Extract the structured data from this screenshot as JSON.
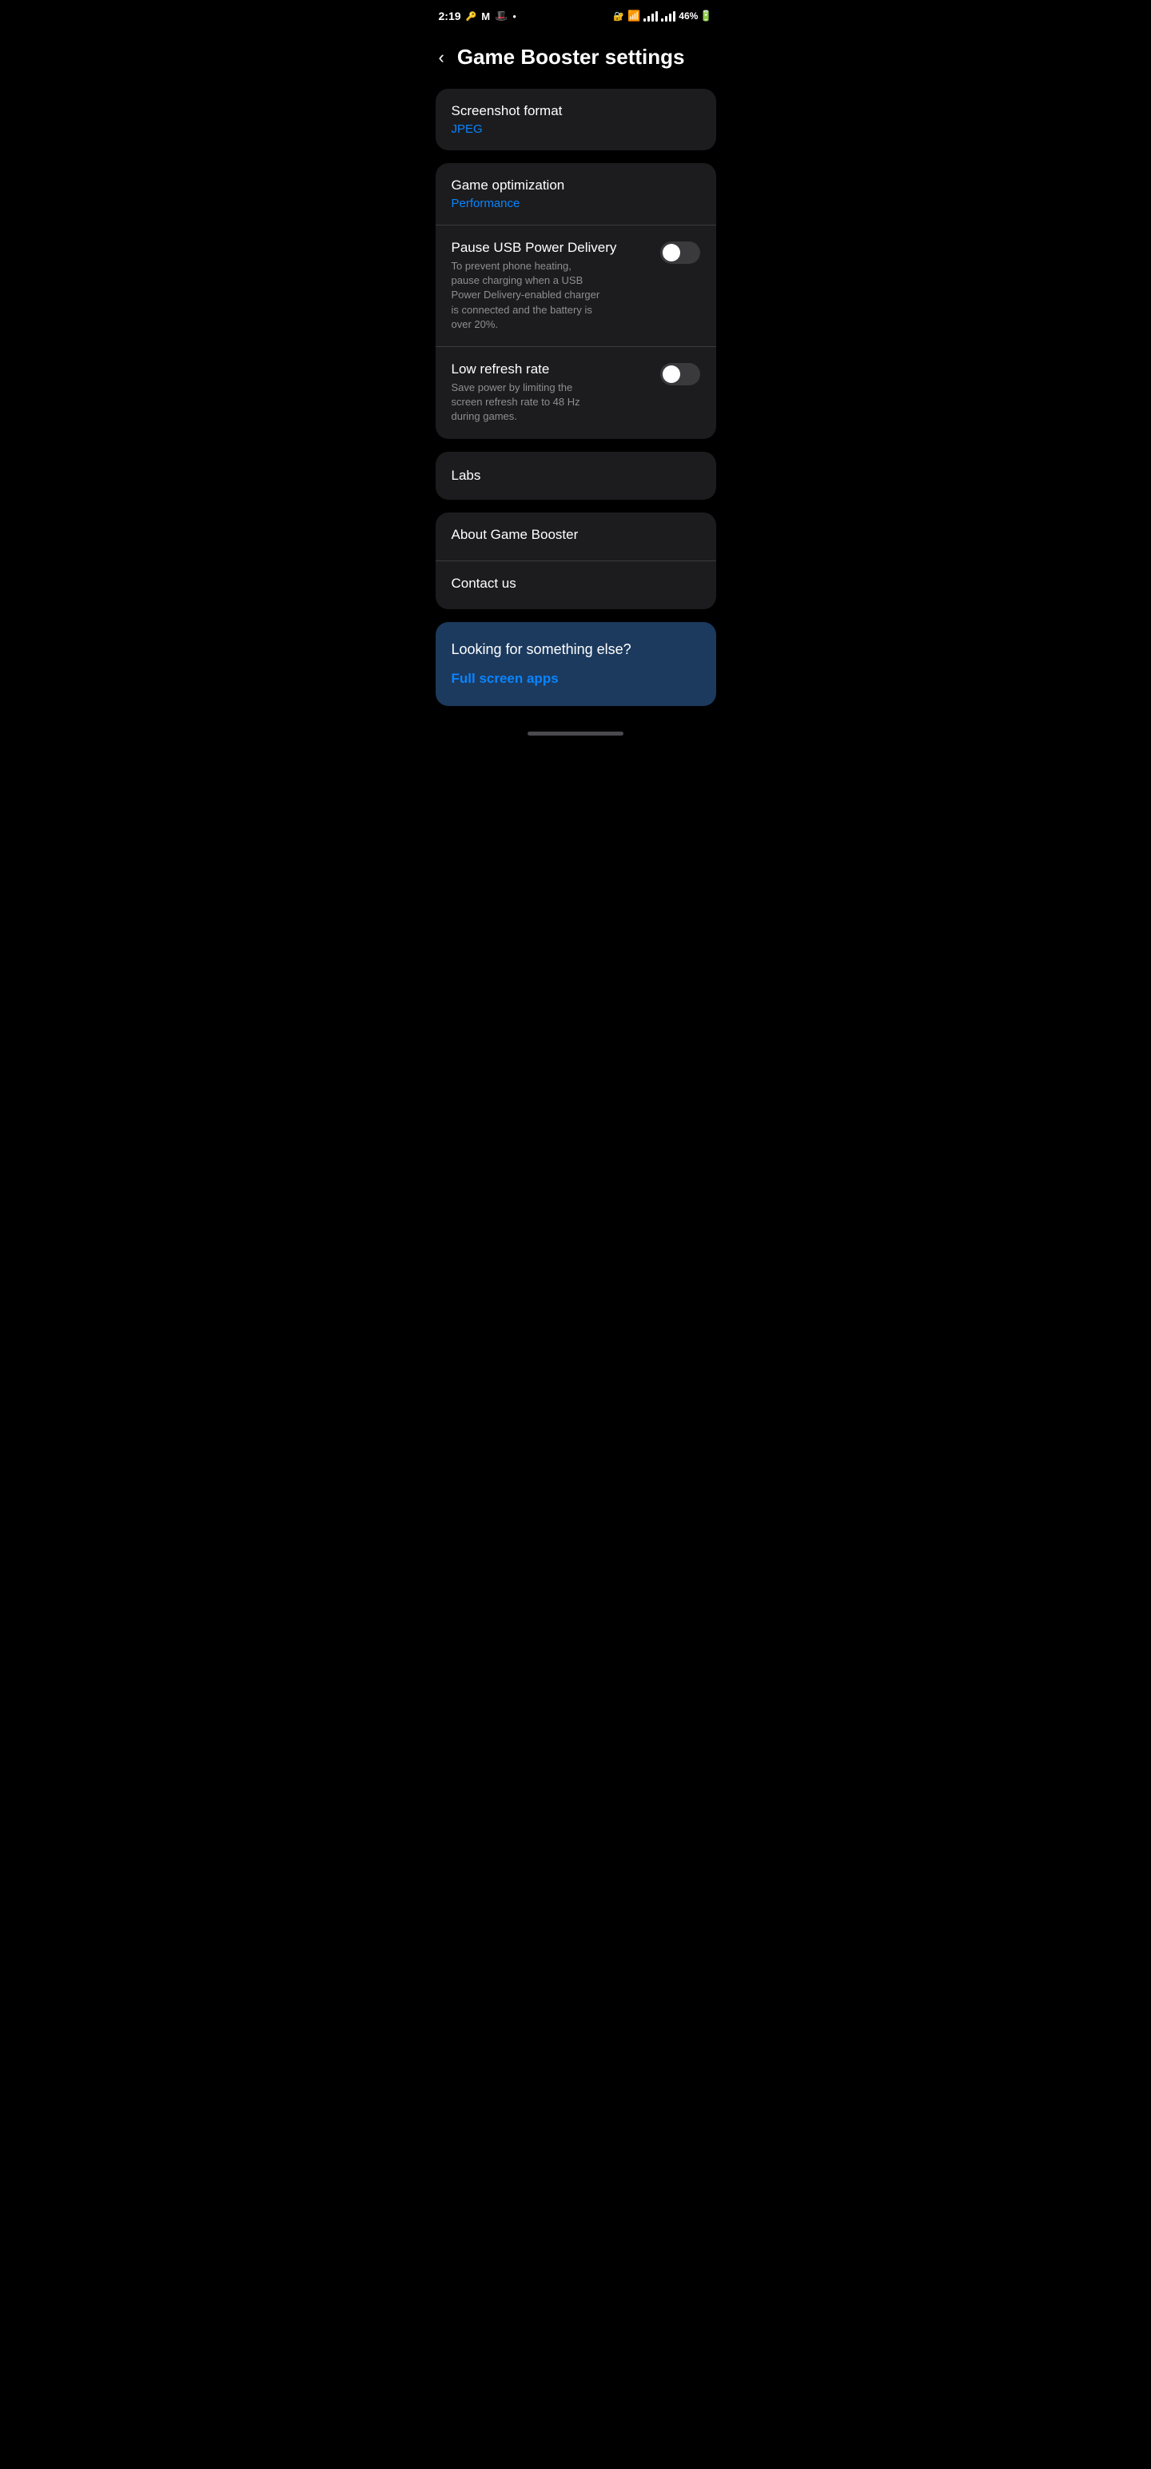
{
  "statusBar": {
    "time": "2:19",
    "battery": "46%",
    "icons": {
      "vpn": "🔑",
      "mail": "M",
      "notification": "●"
    }
  },
  "header": {
    "backLabel": "‹",
    "title": "Game Booster settings"
  },
  "cards": {
    "screenshotFormat": {
      "label": "Screenshot format",
      "value": "JPEG"
    },
    "gameOptimization": {
      "label": "Game optimization",
      "value": "Performance",
      "items": [
        {
          "title": "Pause USB Power Delivery",
          "description": "To prevent phone heating, pause charging when a USB Power Delivery-enabled charger is connected and the battery is over 20%.",
          "enabled": false
        },
        {
          "title": "Low refresh rate",
          "description": "Save power by limiting the screen refresh rate to 48 Hz during games.",
          "enabled": false
        }
      ]
    },
    "labs": {
      "label": "Labs"
    },
    "aboutAndContact": {
      "items": [
        {
          "label": "About Game Booster"
        },
        {
          "label": "Contact us"
        }
      ]
    },
    "lookingForSomething": {
      "title": "Looking for something else?",
      "linkText": "Full screen apps"
    }
  }
}
